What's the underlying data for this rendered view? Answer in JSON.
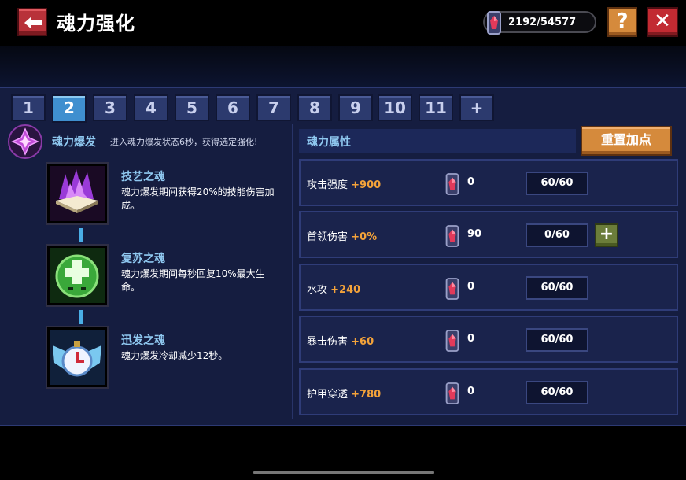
{
  "header": {
    "title": "魂力强化",
    "soul_gems": "2192/54577",
    "help_label": "?",
    "close_label": "✕"
  },
  "tabs": [
    "1",
    "2",
    "3",
    "4",
    "5",
    "6",
    "7",
    "8",
    "9",
    "10",
    "11",
    "+"
  ],
  "active_tab": "2",
  "burst": {
    "label": "魂力爆发",
    "description": "进入魂力爆发状态6秒，获得选定强化!"
  },
  "skills": [
    {
      "name": "技艺之魂",
      "description": "魂力爆发期间获得20%的技能伤害加成。",
      "icon": "purple-flame-book-icon"
    },
    {
      "name": "复苏之魂",
      "description": "魂力爆发期间每秒回复10%最大生命。",
      "icon": "green-heal-orb-icon"
    },
    {
      "name": "迅发之魂",
      "description": "魂力爆发冷却减少12秒。",
      "icon": "winged-clock-icon"
    }
  ],
  "attributes": {
    "header": "魂力属性",
    "reset_label": "重置加点",
    "rows": [
      {
        "label": "攻击强度",
        "bonus": "+900",
        "cost": "0",
        "level": "60/60",
        "has_plus": false
      },
      {
        "label": "首领伤害",
        "bonus": "+0%",
        "cost": "90",
        "level": "0/60",
        "has_plus": true
      },
      {
        "label": "水攻",
        "bonus": "+240",
        "cost": "0",
        "level": "60/60",
        "has_plus": false
      },
      {
        "label": "暴击伤害",
        "bonus": "+60",
        "cost": "0",
        "level": "60/60",
        "has_plus": false
      },
      {
        "label": "护甲穿透",
        "bonus": "+780",
        "cost": "0",
        "level": "60/60",
        "has_plus": false
      }
    ],
    "plus_label": "+"
  },
  "colors": {
    "accent_blue": "#3f8fcf",
    "bonus_orange": "#f3a23a",
    "button_orange": "#d58a3c",
    "danger_red": "#c22a32"
  }
}
